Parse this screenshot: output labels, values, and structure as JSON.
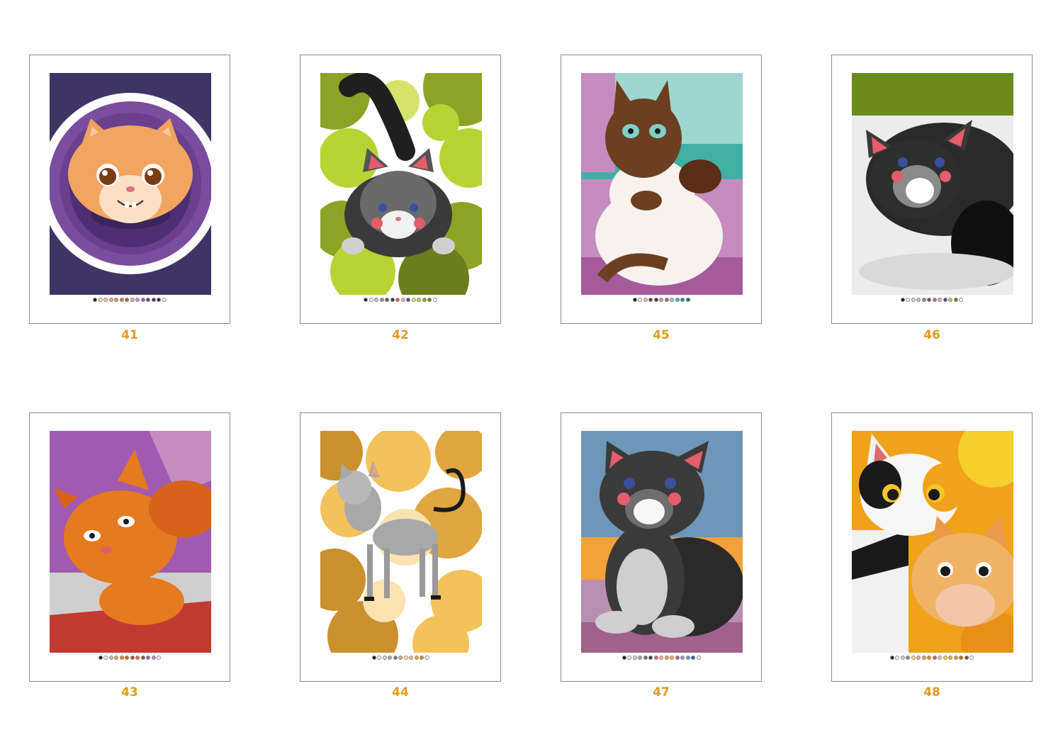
{
  "pages": [
    {
      "number": "41",
      "palette": [
        "#1a1a1a",
        "#f7e7c8",
        "#f2c79c",
        "#e9a770",
        "#e88c4b",
        "#d9773b",
        "#b85a24",
        "#f0a6a6",
        "#c98cd1",
        "#8a5fb0",
        "#5c3f8f",
        "#3b2c6e",
        "#2a2a5a",
        "#ffffff"
      ]
    },
    {
      "number": "42",
      "palette": [
        "#1a1a1a",
        "#f2f2f2",
        "#bdbdbd",
        "#8a8a8a",
        "#5a5a5a",
        "#3a3a3a",
        "#e35d6a",
        "#f4a6b0",
        "#3a4fa0",
        "#d6e36b",
        "#b7d433",
        "#8da325",
        "#6b7d1c",
        "#ffffff"
      ]
    },
    {
      "number": "45",
      "palette": [
        "#1a1a1a",
        "#f2f2f2",
        "#d8c7b0",
        "#6b3f20",
        "#4a2a14",
        "#c58cbf",
        "#a45a9b",
        "#7fd1c8",
        "#3fb0a3",
        "#248a80",
        "#1a6b63"
      ]
    },
    {
      "number": "46",
      "palette": [
        "#1a1a1a",
        "#f2f2f2",
        "#d9d9d9",
        "#bdbdbd",
        "#8a8a8a",
        "#5a5a5a",
        "#e35d6a",
        "#f4a6b0",
        "#3a4fa0",
        "#b7d433",
        "#6b7d1c",
        "#ffffff"
      ]
    },
    {
      "number": "43",
      "palette": [
        "#1a1a1a",
        "#f2f2f2",
        "#bdbdbd",
        "#f29a3a",
        "#e57a1f",
        "#d9621a",
        "#c24a14",
        "#e35d4a",
        "#c23a30",
        "#a05ab0",
        "#c58cbf",
        "#ffffff"
      ]
    },
    {
      "number": "44",
      "palette": [
        "#1a1a1a",
        "#f2f2f2",
        "#cfcfcf",
        "#a8a8a8",
        "#7a7a7a",
        "#f0a080",
        "#fbe2b0",
        "#f3c25a",
        "#e0a640",
        "#c9902c",
        "#ffffff"
      ]
    },
    {
      "number": "47",
      "palette": [
        "#1a1a1a",
        "#f2f2f2",
        "#cfcfcf",
        "#a8a8a8",
        "#6e6e6e",
        "#3a3a3a",
        "#e35d6a",
        "#f4a6b0",
        "#f2a238",
        "#e6c24a",
        "#a0628a",
        "#b98fb0",
        "#6e96b8",
        "#3a4fa0",
        "#ffffff"
      ]
    },
    {
      "number": "48",
      "palette": [
        "#1a1a1a",
        "#f2f2f2",
        "#d0d0d0",
        "#8a8a8a",
        "#f7d28a",
        "#f2b266",
        "#ea9a4a",
        "#e0803a",
        "#d9653a",
        "#f4c6a8",
        "#f5cf2a",
        "#f0a21a",
        "#e89018",
        "#c26a18",
        "#8a4a14",
        "#ffffff"
      ]
    }
  ]
}
